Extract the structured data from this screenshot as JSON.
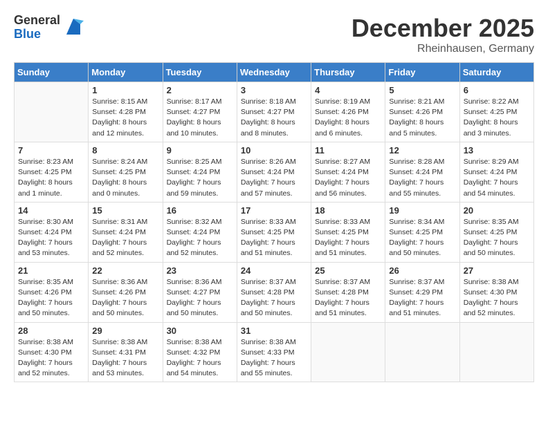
{
  "header": {
    "logo_general": "General",
    "logo_blue": "Blue",
    "month_year": "December 2025",
    "location": "Rheinhausen, Germany"
  },
  "days_of_week": [
    "Sunday",
    "Monday",
    "Tuesday",
    "Wednesday",
    "Thursday",
    "Friday",
    "Saturday"
  ],
  "weeks": [
    [
      {
        "num": "",
        "info": ""
      },
      {
        "num": "1",
        "info": "Sunrise: 8:15 AM\nSunset: 4:28 PM\nDaylight: 8 hours\nand 12 minutes."
      },
      {
        "num": "2",
        "info": "Sunrise: 8:17 AM\nSunset: 4:27 PM\nDaylight: 8 hours\nand 10 minutes."
      },
      {
        "num": "3",
        "info": "Sunrise: 8:18 AM\nSunset: 4:27 PM\nDaylight: 8 hours\nand 8 minutes."
      },
      {
        "num": "4",
        "info": "Sunrise: 8:19 AM\nSunset: 4:26 PM\nDaylight: 8 hours\nand 6 minutes."
      },
      {
        "num": "5",
        "info": "Sunrise: 8:21 AM\nSunset: 4:26 PM\nDaylight: 8 hours\nand 5 minutes."
      },
      {
        "num": "6",
        "info": "Sunrise: 8:22 AM\nSunset: 4:25 PM\nDaylight: 8 hours\nand 3 minutes."
      }
    ],
    [
      {
        "num": "7",
        "info": "Sunrise: 8:23 AM\nSunset: 4:25 PM\nDaylight: 8 hours\nand 1 minute."
      },
      {
        "num": "8",
        "info": "Sunrise: 8:24 AM\nSunset: 4:25 PM\nDaylight: 8 hours\nand 0 minutes."
      },
      {
        "num": "9",
        "info": "Sunrise: 8:25 AM\nSunset: 4:24 PM\nDaylight: 7 hours\nand 59 minutes."
      },
      {
        "num": "10",
        "info": "Sunrise: 8:26 AM\nSunset: 4:24 PM\nDaylight: 7 hours\nand 57 minutes."
      },
      {
        "num": "11",
        "info": "Sunrise: 8:27 AM\nSunset: 4:24 PM\nDaylight: 7 hours\nand 56 minutes."
      },
      {
        "num": "12",
        "info": "Sunrise: 8:28 AM\nSunset: 4:24 PM\nDaylight: 7 hours\nand 55 minutes."
      },
      {
        "num": "13",
        "info": "Sunrise: 8:29 AM\nSunset: 4:24 PM\nDaylight: 7 hours\nand 54 minutes."
      }
    ],
    [
      {
        "num": "14",
        "info": "Sunrise: 8:30 AM\nSunset: 4:24 PM\nDaylight: 7 hours\nand 53 minutes."
      },
      {
        "num": "15",
        "info": "Sunrise: 8:31 AM\nSunset: 4:24 PM\nDaylight: 7 hours\nand 52 minutes."
      },
      {
        "num": "16",
        "info": "Sunrise: 8:32 AM\nSunset: 4:24 PM\nDaylight: 7 hours\nand 52 minutes."
      },
      {
        "num": "17",
        "info": "Sunrise: 8:33 AM\nSunset: 4:25 PM\nDaylight: 7 hours\nand 51 minutes."
      },
      {
        "num": "18",
        "info": "Sunrise: 8:33 AM\nSunset: 4:25 PM\nDaylight: 7 hours\nand 51 minutes."
      },
      {
        "num": "19",
        "info": "Sunrise: 8:34 AM\nSunset: 4:25 PM\nDaylight: 7 hours\nand 50 minutes."
      },
      {
        "num": "20",
        "info": "Sunrise: 8:35 AM\nSunset: 4:25 PM\nDaylight: 7 hours\nand 50 minutes."
      }
    ],
    [
      {
        "num": "21",
        "info": "Sunrise: 8:35 AM\nSunset: 4:26 PM\nDaylight: 7 hours\nand 50 minutes."
      },
      {
        "num": "22",
        "info": "Sunrise: 8:36 AM\nSunset: 4:26 PM\nDaylight: 7 hours\nand 50 minutes."
      },
      {
        "num": "23",
        "info": "Sunrise: 8:36 AM\nSunset: 4:27 PM\nDaylight: 7 hours\nand 50 minutes."
      },
      {
        "num": "24",
        "info": "Sunrise: 8:37 AM\nSunset: 4:28 PM\nDaylight: 7 hours\nand 50 minutes."
      },
      {
        "num": "25",
        "info": "Sunrise: 8:37 AM\nSunset: 4:28 PM\nDaylight: 7 hours\nand 51 minutes."
      },
      {
        "num": "26",
        "info": "Sunrise: 8:37 AM\nSunset: 4:29 PM\nDaylight: 7 hours\nand 51 minutes."
      },
      {
        "num": "27",
        "info": "Sunrise: 8:38 AM\nSunset: 4:30 PM\nDaylight: 7 hours\nand 52 minutes."
      }
    ],
    [
      {
        "num": "28",
        "info": "Sunrise: 8:38 AM\nSunset: 4:30 PM\nDaylight: 7 hours\nand 52 minutes."
      },
      {
        "num": "29",
        "info": "Sunrise: 8:38 AM\nSunset: 4:31 PM\nDaylight: 7 hours\nand 53 minutes."
      },
      {
        "num": "30",
        "info": "Sunrise: 8:38 AM\nSunset: 4:32 PM\nDaylight: 7 hours\nand 54 minutes."
      },
      {
        "num": "31",
        "info": "Sunrise: 8:38 AM\nSunset: 4:33 PM\nDaylight: 7 hours\nand 55 minutes."
      },
      {
        "num": "",
        "info": ""
      },
      {
        "num": "",
        "info": ""
      },
      {
        "num": "",
        "info": ""
      }
    ]
  ]
}
